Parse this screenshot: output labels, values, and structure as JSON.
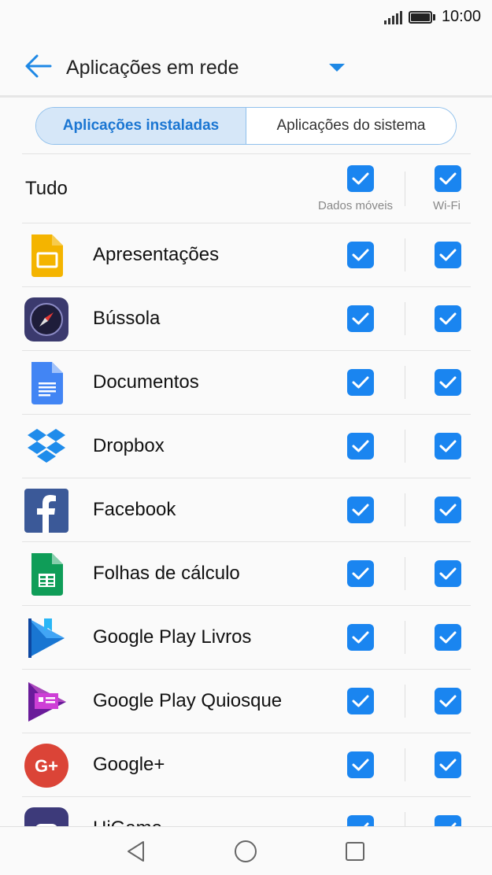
{
  "status": {
    "time": "10:00"
  },
  "header": {
    "title": "Aplicações em rede"
  },
  "tabs": [
    {
      "label": "Aplicações instaladas",
      "active": true
    },
    {
      "label": "Aplicações do sistema",
      "active": false
    }
  ],
  "all_row": {
    "label": "Tudo",
    "mobile_data_label": "Dados móveis",
    "wifi_label": "Wi-Fi",
    "mobile_data_checked": true,
    "wifi_checked": true
  },
  "apps": [
    {
      "name": "Apresentações",
      "icon": "slides-icon",
      "mobile_data": true,
      "wifi": true
    },
    {
      "name": "Bússola",
      "icon": "compass-icon",
      "mobile_data": true,
      "wifi": true
    },
    {
      "name": "Documentos",
      "icon": "docs-icon",
      "mobile_data": true,
      "wifi": true
    },
    {
      "name": "Dropbox",
      "icon": "dropbox-icon",
      "mobile_data": true,
      "wifi": true
    },
    {
      "name": "Facebook",
      "icon": "facebook-icon",
      "mobile_data": true,
      "wifi": true
    },
    {
      "name": "Folhas de cálculo",
      "icon": "sheets-icon",
      "mobile_data": true,
      "wifi": true
    },
    {
      "name": "Google Play Livros",
      "icon": "play-books-icon",
      "mobile_data": true,
      "wifi": true
    },
    {
      "name": "Google Play Quiosque",
      "icon": "play-newsstand-icon",
      "mobile_data": true,
      "wifi": true
    },
    {
      "name": "Google+",
      "icon": "google-plus-icon",
      "mobile_data": true,
      "wifi": true
    },
    {
      "name": "HiGame",
      "icon": "higame-icon",
      "mobile_data": true,
      "wifi": true
    }
  ],
  "colors": {
    "accent": "#1a85f0",
    "tab_active_bg": "#d6e7f8",
    "tab_active_text": "#1b76d2"
  }
}
